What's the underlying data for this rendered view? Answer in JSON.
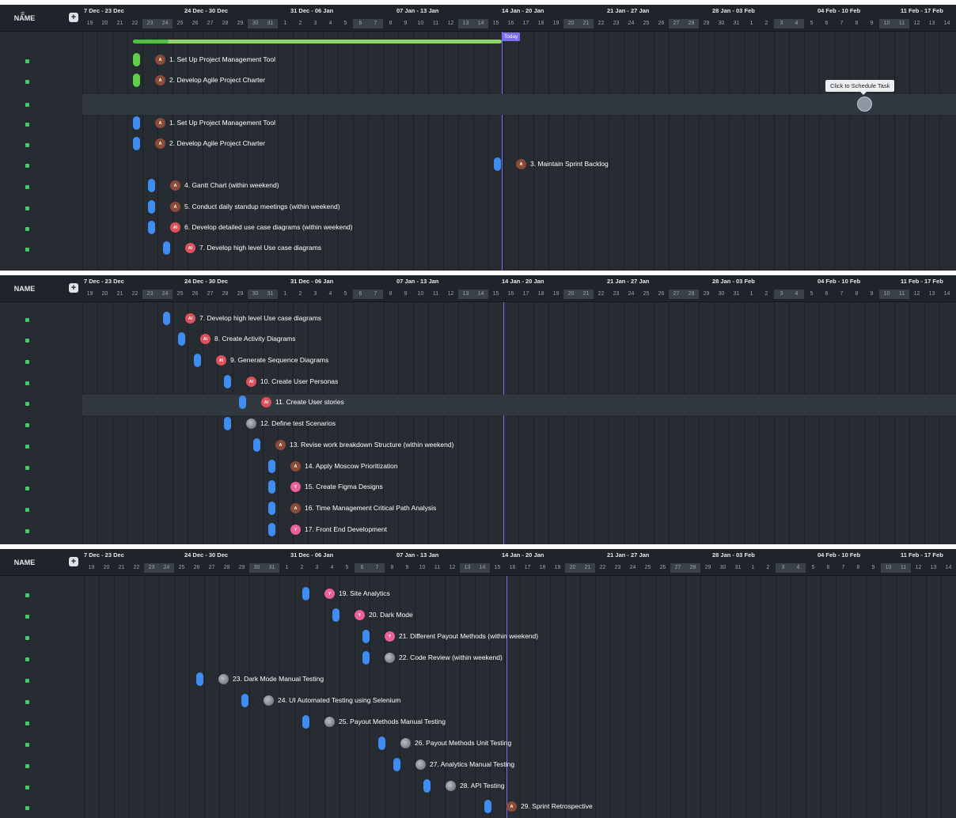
{
  "header": {
    "name_label": "NAME",
    "add_icon": "plus-square-icon",
    "today_label": "Today"
  },
  "weeks": [
    "7 Dec - 23 Dec",
    "24 Dec - 30 Dec",
    "31 Dec - 06 Jan",
    "07 Jan - 13 Jan",
    "14 Jan - 20 Jan",
    "21 Jan - 27 Jan",
    "28 Jan - 03 Feb",
    "04 Feb - 10 Feb",
    "11 Feb - 17 Feb"
  ],
  "days": [
    "19",
    "20",
    "21",
    "22",
    "23",
    "24",
    "25",
    "26",
    "27",
    "28",
    "29",
    "30",
    "31",
    "1",
    "2",
    "3",
    "4",
    "5",
    "6",
    "7",
    "8",
    "9",
    "10",
    "11",
    "12",
    "13",
    "14",
    "15",
    "16",
    "17",
    "18",
    "19",
    "20",
    "21",
    "22",
    "23",
    "24",
    "25",
    "26",
    "27",
    "28",
    "29",
    "30",
    "31",
    "1",
    "2",
    "3",
    "4",
    "5",
    "6",
    "7",
    "8",
    "9",
    "10",
    "11",
    "12",
    "13",
    "14"
  ],
  "tooltip": "Click to Schedule Task",
  "colors": {
    "bar": "#3f8cf2",
    "today": "#7b6cf0",
    "progress": "#5fcf4a"
  },
  "panels": [
    {
      "tasks": [
        {
          "label": "1. Set Up Project Management Tool",
          "avatar": "A",
          "avatar_kind": "a",
          "bar": "green"
        },
        {
          "label": "2. Develop Agile Project Charter",
          "avatar": "A",
          "avatar_kind": "a",
          "bar": "green"
        },
        {
          "label": "1. Set Up Project Management Tool",
          "avatar": "A",
          "avatar_kind": "a",
          "bar": "blue"
        },
        {
          "label": "2. Develop Agile Project Charter",
          "avatar": "A",
          "avatar_kind": "a",
          "bar": "blue"
        },
        {
          "label": "3. Maintain Sprint Backlog",
          "avatar": "A",
          "avatar_kind": "a",
          "bar": "blue"
        },
        {
          "label": "4. Gantt Chart (within weekend)",
          "avatar": "A",
          "avatar_kind": "a",
          "bar": "blue"
        },
        {
          "label": "5. Conduct daily standup meetings (within weekend)",
          "avatar": "A",
          "avatar_kind": "a",
          "bar": "blue"
        },
        {
          "label": "6. Develop detailed use case diagrams (within weekend)",
          "avatar": "AI",
          "avatar_kind": "ai",
          "bar": "blue"
        },
        {
          "label": "7. Develop high level Use case diagrams",
          "avatar": "AI",
          "avatar_kind": "ai",
          "bar": "blue"
        }
      ]
    },
    {
      "tasks": [
        {
          "label": "7. Develop high level Use case diagrams",
          "avatar": "AI",
          "avatar_kind": "ai"
        },
        {
          "label": "8. Create Activity Diagrams",
          "avatar": "AI",
          "avatar_kind": "ai"
        },
        {
          "label": "9. Generate Sequence Diagrams",
          "avatar": "AI",
          "avatar_kind": "ai"
        },
        {
          "label": "10. Create User Personas",
          "avatar": "AI",
          "avatar_kind": "ai"
        },
        {
          "label": "11. Create User stories",
          "avatar": "AI",
          "avatar_kind": "ai"
        },
        {
          "label": "12. Define test Scenarios",
          "avatar": "",
          "avatar_kind": "img"
        },
        {
          "label": "13. Revise work breakdown Structure (within weekend)",
          "avatar": "A",
          "avatar_kind": "a"
        },
        {
          "label": "14. Apply Moscow Prioritization",
          "avatar": "A",
          "avatar_kind": "a"
        },
        {
          "label": "15. Create Figma Designs",
          "avatar": "Y",
          "avatar_kind": "y"
        },
        {
          "label": "16. Time Management Critical Path Analysis",
          "avatar": "A",
          "avatar_kind": "a"
        },
        {
          "label": "17. Front End Development",
          "avatar": "Y",
          "avatar_kind": "y"
        }
      ]
    },
    {
      "tasks": [
        {
          "label": "19. Site Analytics",
          "avatar": "Y",
          "avatar_kind": "y"
        },
        {
          "label": "20. Dark Mode",
          "avatar": "Y",
          "avatar_kind": "y"
        },
        {
          "label": "21. Different Payout Methods (within weekend)",
          "avatar": "Y",
          "avatar_kind": "y"
        },
        {
          "label": "22. Code Review (within weekend)",
          "avatar": "",
          "avatar_kind": "img"
        },
        {
          "label": "23. Dark Mode Manual Testing",
          "avatar": "",
          "avatar_kind": "img"
        },
        {
          "label": "24. UI Automated Testing using Selenium",
          "avatar": "",
          "avatar_kind": "img"
        },
        {
          "label": "25. Payout Methods Manual Testing",
          "avatar": "",
          "avatar_kind": "img"
        },
        {
          "label": "26. Payout Methods Unit Testing",
          "avatar": "",
          "avatar_kind": "img"
        },
        {
          "label": "27. Analytics Manual Testing",
          "avatar": "",
          "avatar_kind": "img"
        },
        {
          "label": "28. API Testing",
          "avatar": "",
          "avatar_kind": "img"
        },
        {
          "label": "29. Sprint Retrospective",
          "avatar": "A",
          "avatar_kind": "a"
        }
      ]
    }
  ]
}
